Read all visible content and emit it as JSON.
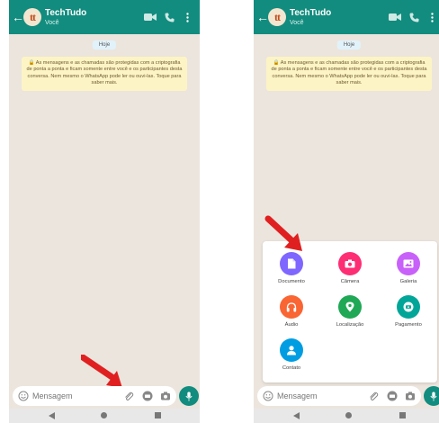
{
  "contact": {
    "name": "TechTudo",
    "status": "Você",
    "avatar_text": "tt"
  },
  "chat": {
    "date_label": "Hoje",
    "security_notice": "🔒 As mensagens e as chamadas são protegidas com a criptografia de ponta a ponta e ficam somente entre você e os participantes desta conversa. Nem mesmo o WhatsApp pode ler ou ouvi-las. Toque para saber mais."
  },
  "input": {
    "placeholder": "Mensagem"
  },
  "attach_menu": {
    "items": [
      {
        "label": "Documento",
        "icon": "document-icon",
        "color": "#7f66ff"
      },
      {
        "label": "Câmera",
        "icon": "camera-icon",
        "color": "#fe2e74"
      },
      {
        "label": "Galeria",
        "icon": "gallery-icon",
        "color": "#c861f9"
      },
      {
        "label": "Áudio",
        "icon": "headphones-icon",
        "color": "#f96533"
      },
      {
        "label": "Localização",
        "icon": "location-icon",
        "color": "#1fa855"
      },
      {
        "label": "Pagamento",
        "icon": "payment-icon",
        "color": "#02a698"
      },
      {
        "label": "Contato",
        "icon": "contact-icon",
        "color": "#009de2"
      }
    ]
  },
  "colors": {
    "header": "#128c7e",
    "chat_bg": "#ece5dd",
    "arrow": "#e02020",
    "notice_bg": "#fdf4c5"
  }
}
